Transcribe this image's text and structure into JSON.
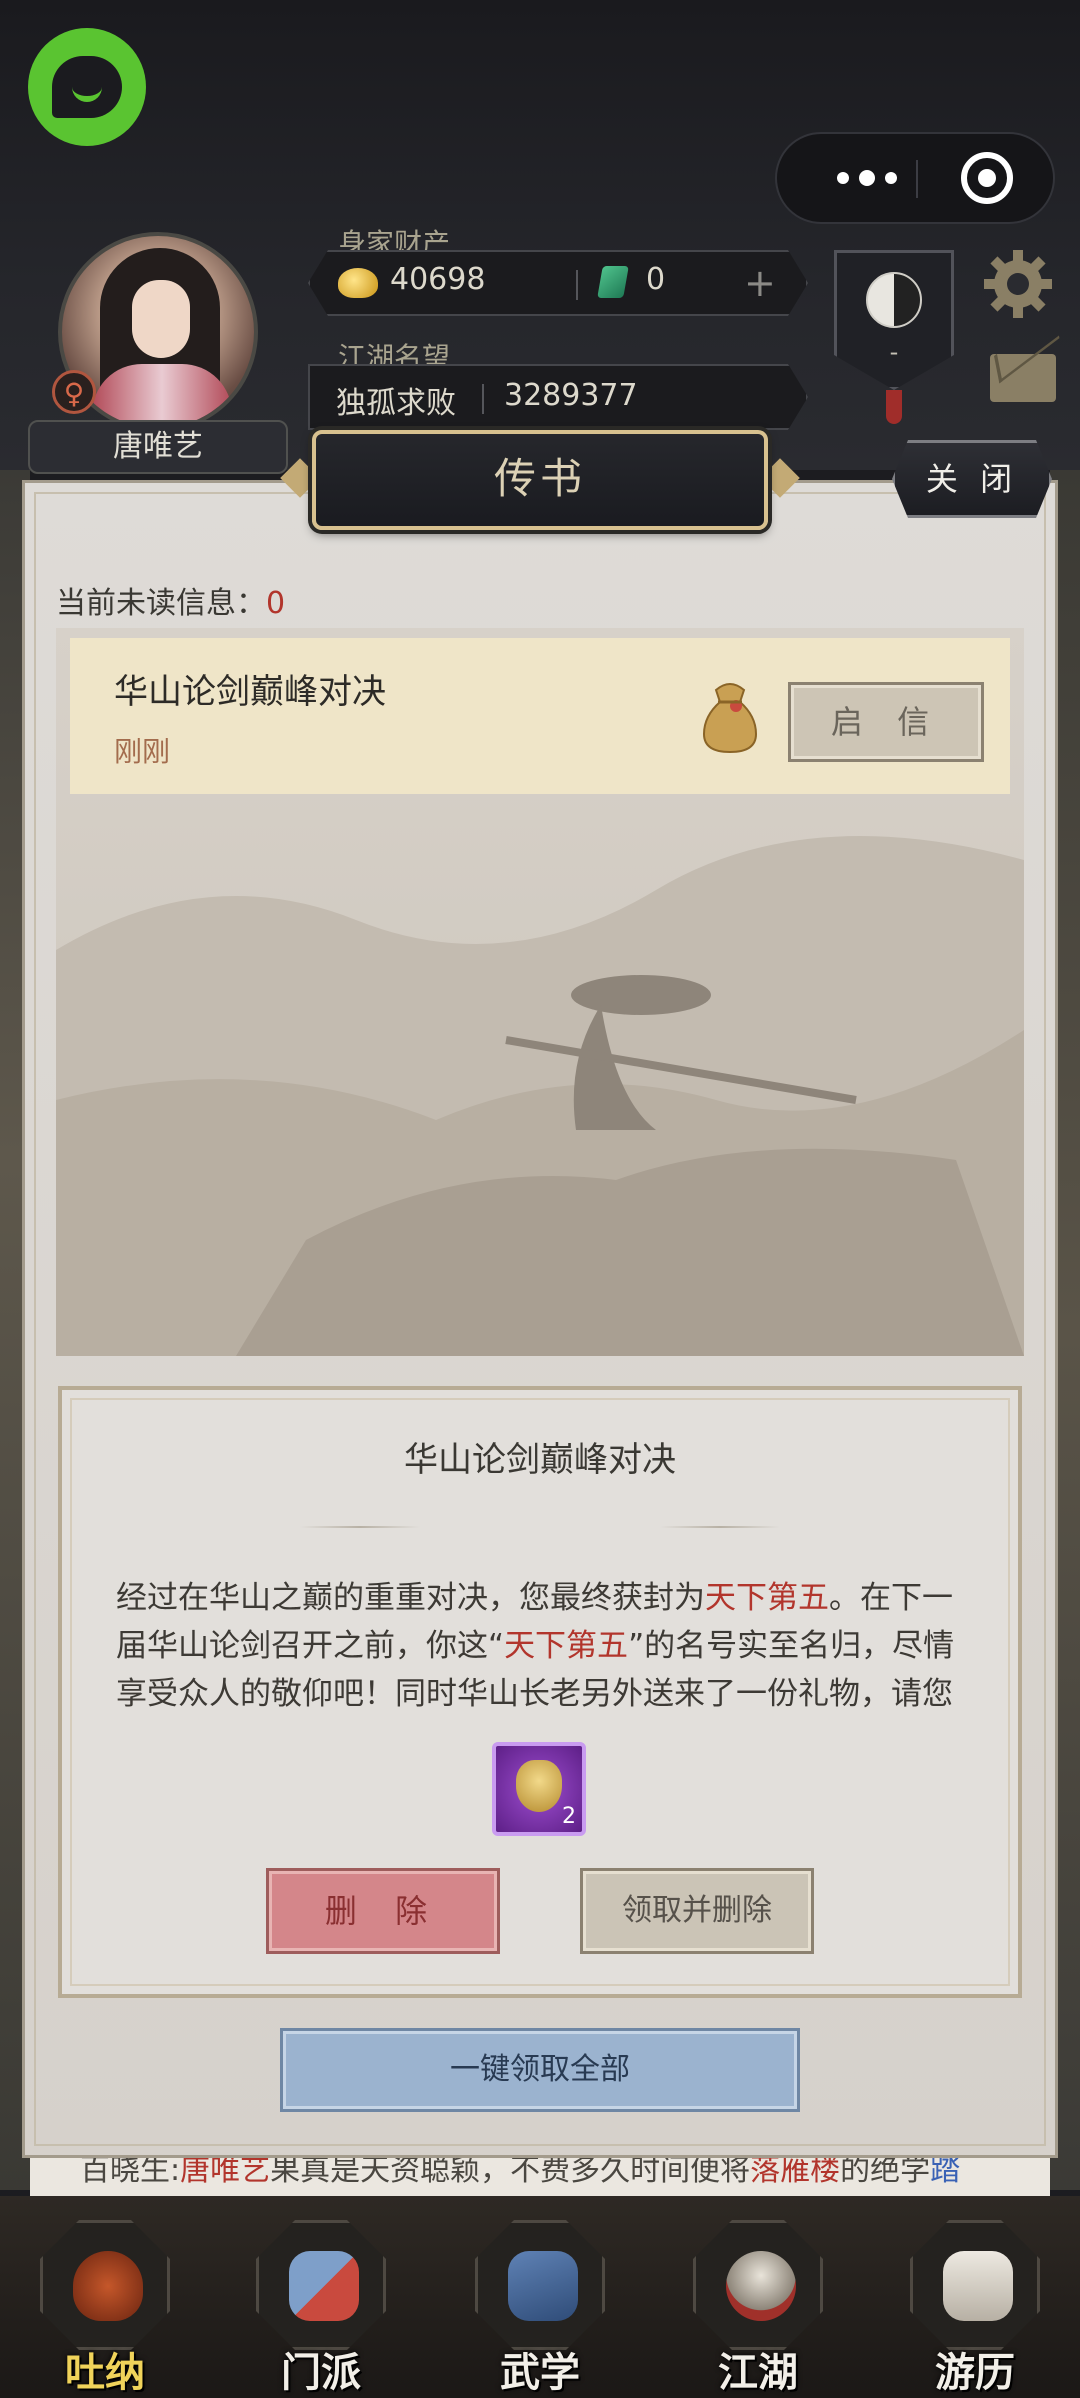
{
  "header": {
    "wealth_label": "身家财产",
    "gold": "40698",
    "jade": "0",
    "add_symbol": "+",
    "reputation_label": "江湖名望",
    "reputation_title": "独孤求败",
    "reputation_value": "3289377",
    "yinyang_label": "-",
    "gender_symbol": "♀"
  },
  "player": {
    "name": "唐唯艺"
  },
  "dialog": {
    "title": "传书",
    "close_label": "关 闭",
    "unread_label": "当前未读信息：",
    "unread_count": "0",
    "message": {
      "title": "华山论剑巅峰对决",
      "time": "刚刚",
      "open_label": "启 信"
    },
    "detail": {
      "title": "华山论剑巅峰对决",
      "body_part1": "经过在华山之巅的重重对决，您最终获封为",
      "highlight1": "天下第五",
      "body_part2": "。在下一届华山论剑召开之前，你这“",
      "highlight2": "天下第五",
      "body_part3": "”的名号实至名归，尽情享受众人的敬仰吧！同时华山长老另外送来了一份礼物，请您",
      "reward_count": "2",
      "delete_label": "删 除",
      "claim_delete_label": "领取并删除"
    },
    "claim_all_label": "一键领取全部"
  },
  "chat": {
    "prefix": "百晓生:",
    "name": "唐唯艺",
    "mid": "果真是天资聪颖，不费多久时间便将",
    "place": "落雁楼",
    "suffix": "的绝学",
    "link": "踏"
  },
  "nav": [
    {
      "label": "吐纳",
      "icon": "gourd-icon"
    },
    {
      "label": "门派",
      "icon": "flag-icon"
    },
    {
      "label": "武学",
      "icon": "scroll-icon"
    },
    {
      "label": "江湖",
      "icon": "hat-icon"
    },
    {
      "label": "游历",
      "icon": "horse-icon"
    }
  ],
  "colors": {
    "accent_red": "#b2352c",
    "highlight_gold": "#f0d35a",
    "message_bg": "#efe5c8"
  }
}
